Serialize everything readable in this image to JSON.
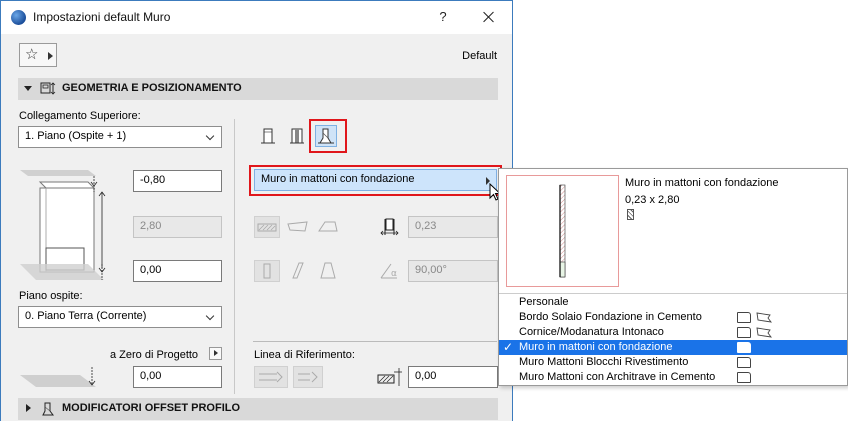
{
  "window": {
    "title": "Impostazioni default Muro",
    "help_label": "?"
  },
  "toolbar": {
    "favorites_icon": "star-icon",
    "default_label": "Default"
  },
  "sections": {
    "geometry_title": "GEOMETRIA E POSIZIONAMENTO",
    "offset_title": "MODIFICATORI OFFSET PROFILO"
  },
  "top_link": {
    "label": "Collegamento Superiore:",
    "value": "1. Piano (Ospite + 1)"
  },
  "heights": {
    "top_offset": "-0,80",
    "height": "2,80",
    "bottom_offset": "0,00"
  },
  "home_story": {
    "label": "Piano ospite:",
    "value": "0. Piano Terra (Corrente)"
  },
  "project_zero": {
    "label": "a Zero di Progetto",
    "value": "0,00"
  },
  "structure": {
    "buttons": [
      "basic-structure-icon",
      "composite-structure-icon",
      "complex-profile-icon"
    ],
    "selected_index": 2
  },
  "profile": {
    "selected": "Muro in mattoni con fondazione"
  },
  "thickness": {
    "value": "0,23"
  },
  "angle": {
    "value": "90,00°"
  },
  "reference_line": {
    "label": "Linea di Riferimento:",
    "offset_value": "0,00"
  },
  "popup": {
    "preview_name": "Muro in mattoni con fondazione",
    "preview_size": "0,23 x 2,80",
    "items": [
      {
        "label": "Personale",
        "icons": []
      },
      {
        "label": "Bordo Solaio Fondazione in Cemento",
        "icons": [
          "wall-icon",
          "beam-icon"
        ]
      },
      {
        "label": "Cornice/Modanatura Intonaco",
        "icons": [
          "wall-icon",
          "beam-icon"
        ]
      },
      {
        "label": "Muro in mattoni con fondazione",
        "icons": [
          "wall-icon"
        ],
        "selected": true
      },
      {
        "label": "Muro Mattoni Blocchi Rivestimento",
        "icons": [
          "wall-icon"
        ]
      },
      {
        "label": "Muro Mattoni con Architrave in Cemento",
        "icons": [
          "wall-icon"
        ]
      }
    ]
  },
  "colors": {
    "selection": "#1a73e8",
    "highlight_box": "#e0161b",
    "section_bar": "#d9d9d9"
  }
}
